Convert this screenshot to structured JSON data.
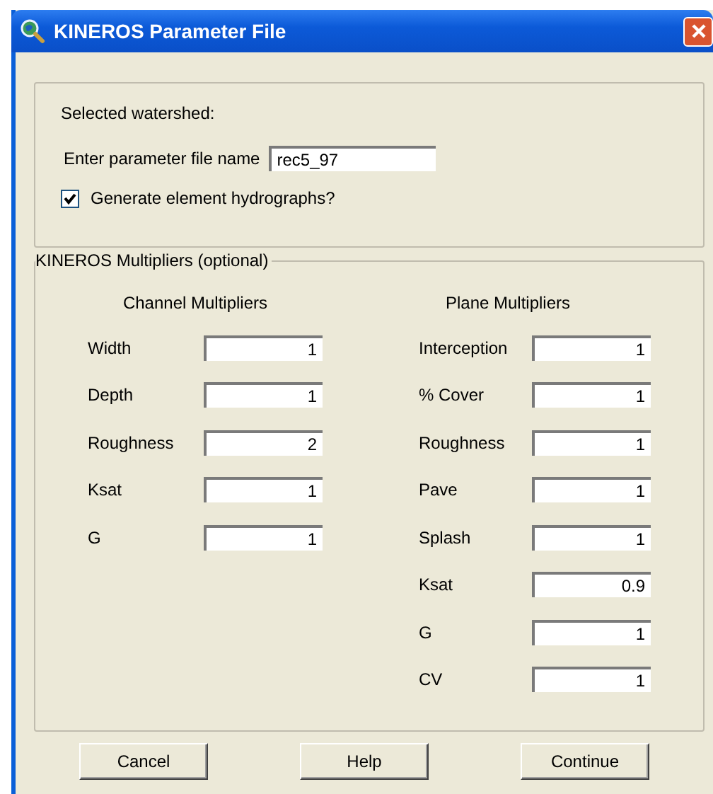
{
  "window": {
    "title": "KINEROS Parameter File"
  },
  "selected_watershed_label": "Selected watershed:",
  "file_name": {
    "label": "Enter parameter file name",
    "value": "rec5_97"
  },
  "generate_hydrographs": {
    "label": "Generate element hydrographs?",
    "checked": true
  },
  "multipliers": {
    "title": "KINEROS Multipliers (optional)",
    "columns": [
      {
        "heading": "Channel Multipliers",
        "fields": [
          {
            "label": "Width",
            "value": "1"
          },
          {
            "label": "Depth",
            "value": "1"
          },
          {
            "label": "Roughness",
            "value": "2"
          },
          {
            "label": "Ksat",
            "value": "1"
          },
          {
            "label": "G",
            "value": "1"
          }
        ]
      },
      {
        "heading": "Plane Multipliers",
        "fields": [
          {
            "label": "Interception",
            "value": "1"
          },
          {
            "label": "% Cover",
            "value": "1"
          },
          {
            "label": "Roughness",
            "value": "1"
          },
          {
            "label": "Pave",
            "value": "1"
          },
          {
            "label": "Splash",
            "value": "1"
          },
          {
            "label": "Ksat",
            "value": "0.9"
          },
          {
            "label": "G",
            "value": "1"
          },
          {
            "label": "CV",
            "value": "1"
          }
        ]
      }
    ]
  },
  "buttons": [
    "Cancel",
    "Help",
    "Continue"
  ]
}
